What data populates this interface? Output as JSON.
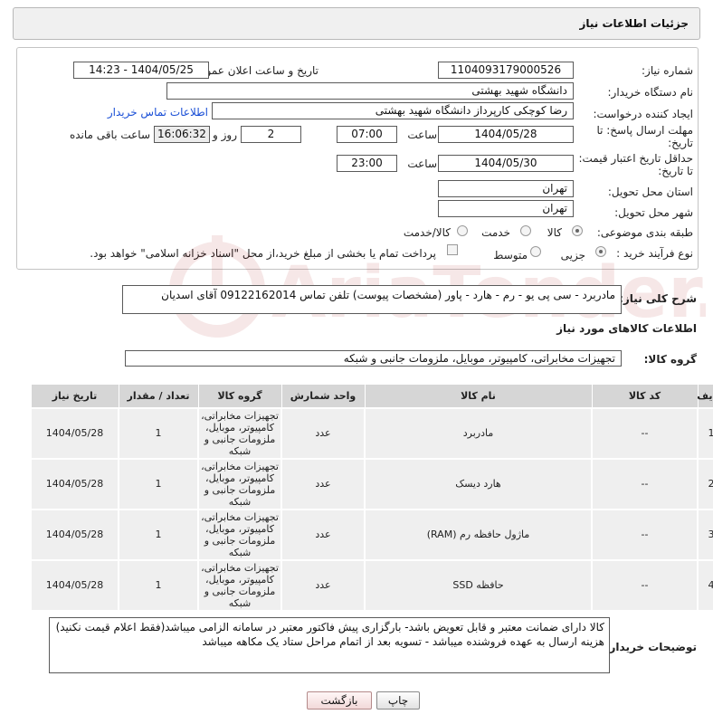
{
  "title": "جزئیات اطلاعات نیاز",
  "need_number_label": "شماره نیاز:",
  "need_number": "1104093179000526",
  "announce_label": "تاریخ و ساعت اعلان عمومی:",
  "announce_value": "1404/05/25 - 14:23",
  "buyer_org_label": "نام دستگاه خریدار:",
  "buyer_org": "دانشگاه شهید بهشتی",
  "creator_label": "ایجاد کننده درخواست:",
  "creator": "رضا کوچکی کارپرداز دانشگاه شهید بهشتی",
  "contact_link": "اطلاعات تماس خریدار",
  "reply_deadline_label_1": "مهلت ارسال پاسخ: تا",
  "reply_deadline_label_2": "تاریخ:",
  "reply_date": "1404/05/28",
  "hour_label": "ساعت",
  "reply_time": "07:00",
  "days_value": "2",
  "days_label": "روز و",
  "remaining_time": "16:06:32",
  "remaining_label": "ساعت باقی مانده",
  "price_deadline_label_1": "حداقل تاریخ اعتبار قیمت:",
  "price_deadline_label_2": "تا تاریخ:",
  "price_date": "1404/05/30",
  "price_time": "23:00",
  "province_label": "استان محل تحویل:",
  "province": "تهران",
  "city_label": "شهر محل تحویل:",
  "city": "تهران",
  "category_label": "طبقه بندی موضوعی:",
  "category_options": [
    "کالا",
    "خدمت",
    "کالا/خدمت"
  ],
  "purchase_type_label": "نوع فرآیند خرید :",
  "purchase_options": [
    "جزیی",
    "متوسط"
  ],
  "payment_note": "پرداخت تمام یا بخشی از مبلغ خرید،از محل \"اسناد خزانه اسلامی\" خواهد بود.",
  "description_label": "شرح کلی نیاز:",
  "description": "مادربرد - سی پی یو - رم - هارد - پاور (مشخصات پیوست) تلفن تماس 09122162014 آقای اسدیان",
  "goods_info_header": "اطلاعات کالاهای مورد نیاز",
  "goods_group_label": "گروه کالا:",
  "goods_group": "تجهیزات مخابراتی، کامپیوتر، موبایل، ملزومات جانبی و شبکه",
  "table": {
    "headers": [
      "ردیف",
      "کد کالا",
      "نام کالا",
      "واحد شمارش",
      "گروه کالا",
      "تعداد / مقدار",
      "تاریخ نیاز"
    ],
    "rows": [
      {
        "row": "1",
        "code": "--",
        "name": "مادربرد",
        "unit": "عدد",
        "group": "تجهیزات مخابراتی، کامپیوتر، موبایل، ملزومات جانبی و شبکه",
        "qty": "1",
        "date": "1404/05/28"
      },
      {
        "row": "2",
        "code": "--",
        "name": "هارد دیسک",
        "unit": "عدد",
        "group": "تجهیزات مخابراتی، کامپیوتر، موبایل، ملزومات جانبی و شبکه",
        "qty": "1",
        "date": "1404/05/28"
      },
      {
        "row": "3",
        "code": "--",
        "name": "ماژول حافظه رم (RAM)",
        "unit": "عدد",
        "group": "تجهیزات مخابراتی، کامپیوتر، موبایل، ملزومات جانبی و شبکه",
        "qty": "1",
        "date": "1404/05/28"
      },
      {
        "row": "4",
        "code": "--",
        "name": "حافظه SSD",
        "unit": "عدد",
        "group": "تجهیزات مخابراتی، کامپیوتر، موبایل، ملزومات جانبی و شبکه",
        "qty": "1",
        "date": "1404/05/28"
      }
    ]
  },
  "buyer_notes_label": "توضیحات خریدار:",
  "buyer_notes_line1": "کالا دارای ضمانت معتبر و قابل تعویض باشد- بارگزاری پیش فاکتور معتبر در سامانه الزامی میباشد(فقط اعلام قیمت نکنید)",
  "buyer_notes_line2": "هزینه ارسال به عهده فروشنده میباشد - تسویه بعد از اتمام مراحل ستاد یک مکاهه میباشد",
  "print_button": "چاپ",
  "back_button": "بازگشت",
  "watermark_text": "AriaTender.neT",
  "colors": {
    "link": "#1a4fd6",
    "table_header": "#d6d6d6",
    "table_cell": "#efefef",
    "back_button": "#f2d9d9"
  }
}
